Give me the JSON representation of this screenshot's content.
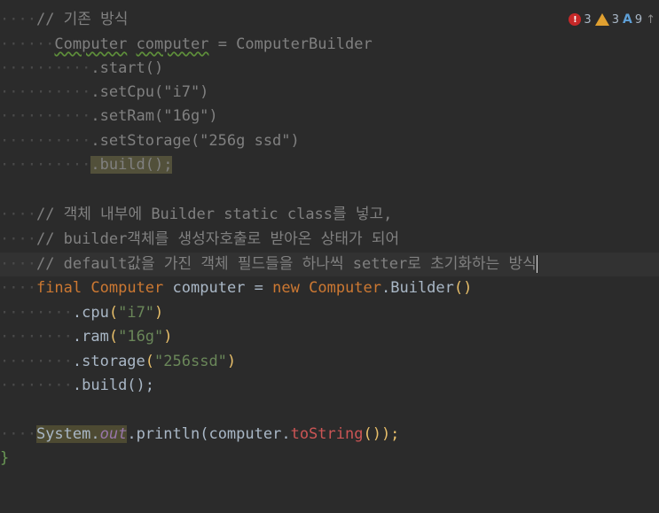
{
  "status": {
    "errors": "3",
    "warnings": "3",
    "typos": "9",
    "typo_glyph": "A",
    "up_glyph": "↑"
  },
  "code": {
    "l1_comment": "// 기존 방식",
    "l2_type": "Computer",
    "l2_var": "computer",
    "l2_eq": " = ",
    "l2_builder": "ComputerBuilder",
    "l3": ".start()",
    "l4": ".setCpu(\"i7\")",
    "l5": ".setRam(\"16g\")",
    "l6": ".setStorage(\"256g ssd\")",
    "l7": ".build();",
    "l9_comment": "// 객체 내부에 Builder static class를 넣고,",
    "l10_comment": "// builder객체를 생성자호출로 받아온 상태가 되어",
    "l11_comment": "// default값을 가진 객체 필드들을 하나씩 setter로 초기화하는 방식",
    "l12_final": "final",
    "l12_type": "Computer",
    "l12_var": "computer",
    "l12_eq": " = ",
    "l12_new": "new",
    "l12_cls": "Computer",
    "l12_builder": ".Builder",
    "l13_call": ".cpu",
    "l13_arg": "\"i7\"",
    "l14_call": ".ram",
    "l14_arg": "\"16g\"",
    "l15_call": ".storage",
    "l15_arg": "\"256ssd\"",
    "l16": ".build();",
    "l18_system": "System.",
    "l18_out": "out",
    "l18_println": ".println(",
    "l18_obj": "computer.",
    "l18_method": "toString",
    "l18_end": "());",
    "l19": "}"
  }
}
